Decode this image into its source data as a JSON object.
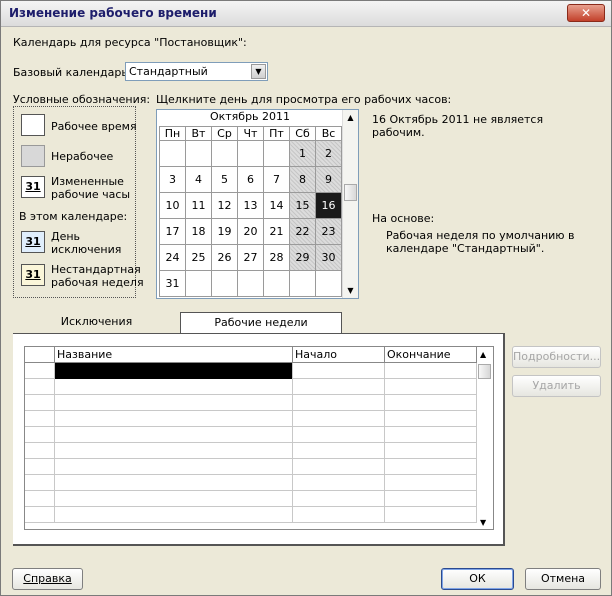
{
  "window": {
    "title": "Изменение рабочего времени",
    "close": "✕"
  },
  "resource_label": "Календарь для ресурса \"Постановщик\":",
  "base_calendar": {
    "label": "Базовый календарь:",
    "value": "Стандартный"
  },
  "legend": {
    "heading": "Условные обозначения:",
    "working": "Рабочее время",
    "nonworking": "Нерабочее",
    "changed_line1": "Измененные",
    "changed_line2": "рабочие часы",
    "changed_num": "31",
    "in_calendar": "В этом календаре:",
    "exception_line1": "День",
    "exception_line2": "исключения",
    "exception_num": "31",
    "nonstandard_line1": "Нестандартная",
    "nonstandard_line2": "рабочая неделя",
    "nonstandard_num": "31"
  },
  "calendar": {
    "prompt": "Щелкните день для просмотра его рабочих часов:",
    "month": "Октябрь 2011",
    "weekdays": [
      "Пн",
      "Вт",
      "Ср",
      "Чт",
      "Пт",
      "Сб",
      "Вс"
    ],
    "weeks": [
      [
        "",
        "",
        "",
        "",
        "",
        "1",
        "2"
      ],
      [
        "3",
        "4",
        "5",
        "6",
        "7",
        "8",
        "9"
      ],
      [
        "10",
        "11",
        "12",
        "13",
        "14",
        "15",
        "16"
      ],
      [
        "17",
        "18",
        "19",
        "20",
        "21",
        "22",
        "23"
      ],
      [
        "24",
        "25",
        "26",
        "27",
        "28",
        "29",
        "30"
      ],
      [
        "31",
        "",
        "",
        "",
        "",
        "",
        ""
      ]
    ],
    "selected_day": "16"
  },
  "info": {
    "day_line1": "16 Октябрь 2011 не является",
    "day_line2": "рабочим.",
    "based_on": "На основе:",
    "based_line1": "Рабочая неделя по умолчанию в",
    "based_line2": "календаре \"Стандартный\"."
  },
  "tabs": {
    "exceptions": "Исключения",
    "work_weeks": "Рабочие недели"
  },
  "table": {
    "col_name": "Название",
    "col_start": "Начало",
    "col_end": "Окончание"
  },
  "side_buttons": {
    "details": "Подробности...",
    "delete": "Удалить"
  },
  "footer": {
    "help": "Справка",
    "ok": "ОК",
    "cancel": "Отмена"
  }
}
